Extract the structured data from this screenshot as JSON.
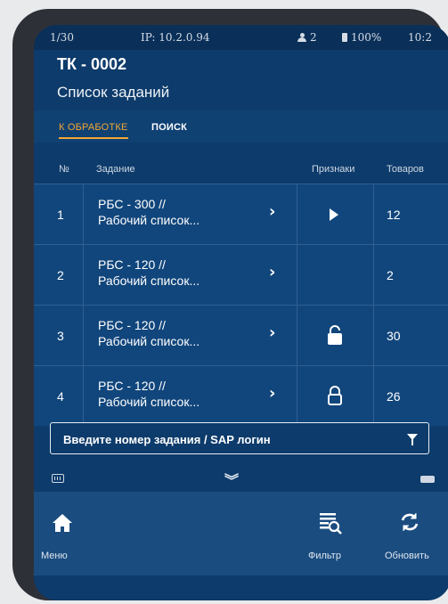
{
  "status_bar": {
    "page": "1/30",
    "ip": "IP: 10.2.0.94",
    "users": "2",
    "battery": "100%",
    "time": "10:2"
  },
  "header": {
    "title": "ТК - 0002",
    "subtitle": "Список заданий"
  },
  "tabs": [
    {
      "label": "К ОБРАБОТКЕ",
      "active": true
    },
    {
      "label": "ПОИСК",
      "active": false
    }
  ],
  "table": {
    "columns": [
      "№",
      "Задание",
      "Признаки",
      "Товаров"
    ],
    "rows": [
      {
        "num": "1",
        "task_line1": "РБС - 300 //",
        "task_line2": "Рабочий список...",
        "flag": "play-icon",
        "count": "12"
      },
      {
        "num": "2",
        "task_line1": "РБС - 120 //",
        "task_line2": "Рабочий список...",
        "flag": "",
        "count": "2"
      },
      {
        "num": "3",
        "task_line1": "РБС - 120 //",
        "task_line2": "Рабочий список...",
        "flag": "lock-closed-icon",
        "count": "30"
      },
      {
        "num": "4",
        "task_line1": "РБС - 120 //",
        "task_line2": "Рабочий список...",
        "flag": "lock-outline-icon",
        "count": "26"
      }
    ]
  },
  "search": {
    "placeholder": "Введите номер задания / SAP логин",
    "value": ""
  },
  "bottom_nav": {
    "menu_label": "Меню",
    "filter_label": "Фильтр",
    "refresh_label": "Обновить"
  },
  "colors": {
    "background": "#0d3b6b",
    "row": "#11467c",
    "accent": "#f3a633",
    "bottom_bar": "#1a4c80"
  }
}
